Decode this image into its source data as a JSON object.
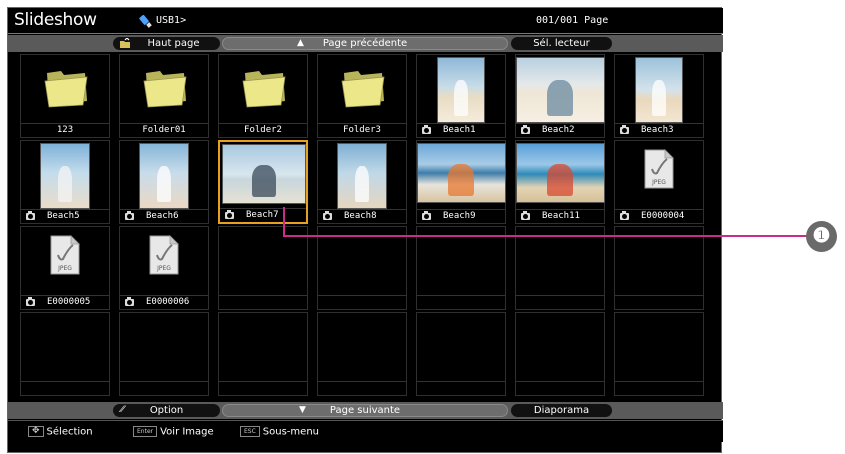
{
  "header": {
    "title": "Slideshow",
    "drive_icon": "usb-drive-icon",
    "drive_label": "USB1>",
    "page_counter": "001/001 Page"
  },
  "nav_top": {
    "home_label": "Haut page",
    "home_icon": "folder-up-icon",
    "prev_label": "Page précédente",
    "prev_icon": "triangle-up-icon",
    "select_drive_label": "Sél. lecteur"
  },
  "nav_bottom": {
    "option_label": "Option",
    "option_icon": "tools-icon",
    "next_label": "Page suivante",
    "next_icon": "triangle-down-icon",
    "slideshow_label": "Diaporama"
  },
  "status": {
    "select_key": "move-cross-icon",
    "select_label": "Sélection",
    "enter_key": "Enter",
    "enter_label": "Voir Image",
    "esc_key": "ESC",
    "esc_label": "Sous-menu"
  },
  "grid": {
    "items": [
      {
        "type": "folder",
        "label": "123"
      },
      {
        "type": "folder",
        "label": "Folder01"
      },
      {
        "type": "folder",
        "label": "Folder2"
      },
      {
        "type": "folder",
        "label": "Folder3"
      },
      {
        "type": "image",
        "label": "Beach1",
        "thumb": "woman-on-beach"
      },
      {
        "type": "image",
        "label": "Beach2",
        "thumb": "beach-chairs"
      },
      {
        "type": "image",
        "label": "Beach3",
        "thumb": "couple-on-beach"
      },
      {
        "type": "image",
        "label": "Beach5",
        "thumb": "woman-portrait"
      },
      {
        "type": "image",
        "label": "Beach6",
        "thumb": "couple-portrait"
      },
      {
        "type": "image",
        "label": "Beach7",
        "thumb": "couple-sitting",
        "selected": true
      },
      {
        "type": "image",
        "label": "Beach8",
        "thumb": "couple-smiling"
      },
      {
        "type": "image",
        "label": "Beach9",
        "thumb": "kids-in-surf"
      },
      {
        "type": "image",
        "label": "Beach11",
        "thumb": "family-with-ball"
      },
      {
        "type": "jpeg",
        "label": "E0000004"
      },
      {
        "type": "jpeg",
        "label": "E0000005"
      },
      {
        "type": "jpeg",
        "label": "E0000006"
      }
    ],
    "jpeg_icon_text": "JPEG",
    "selected_index": 9
  },
  "callout": {
    "marker": "❶",
    "color": "#cc2a8c"
  },
  "colors": {
    "selection_border": "#e8a020",
    "folder_yellow": "#ece88a",
    "navbar_grey": "#5a5a5a"
  }
}
